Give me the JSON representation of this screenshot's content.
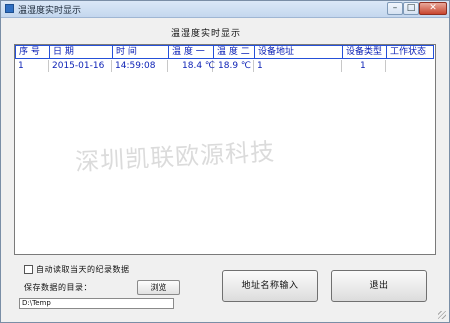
{
  "window": {
    "title": "温湿度实时显示",
    "minimize_glyph": "–",
    "maximize_glyph": "□",
    "close_glyph": "✕"
  },
  "heading": "温湿度实时显示",
  "table": {
    "columns": [
      "序 号",
      "日 期",
      "时 间",
      "温 度 一",
      "温 度 二",
      "设备地址",
      "设备类型",
      "工作状态"
    ],
    "rows": [
      [
        "1",
        "2015-01-16",
        "14:59:08",
        "18.4 ℃",
        "18.9 ℃",
        "1",
        "1",
        ""
      ]
    ]
  },
  "watermark": "深圳凯联欧源科技",
  "options": {
    "auto_read_label": "自动读取当天的纪录数据",
    "auto_read_checked": false
  },
  "save": {
    "label": "保存数据的目录：",
    "browse_label": "浏览",
    "path": "D:\\Temp"
  },
  "buttons": {
    "address_name_input": "地址名称输入",
    "exit": "退出"
  }
}
